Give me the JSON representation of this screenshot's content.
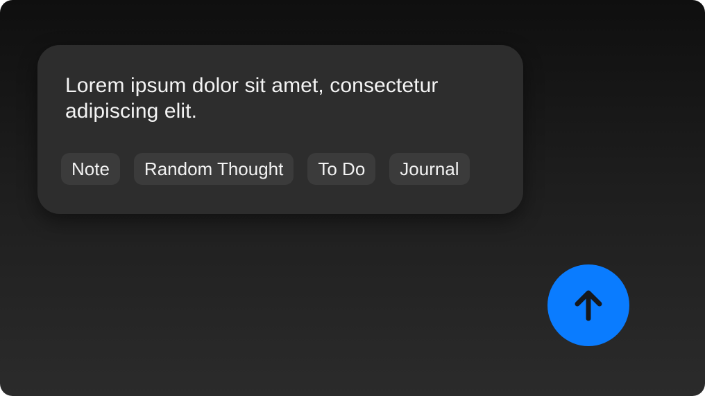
{
  "note": {
    "text": "Lorem ipsum dolor sit amet, consectetur adipiscing elit.",
    "tags": [
      {
        "label": "Note"
      },
      {
        "label": "Random Thought"
      },
      {
        "label": "To Do"
      },
      {
        "label": "Journal"
      }
    ]
  },
  "send_button": {
    "icon": "arrow-up-icon",
    "color": "#0a7cff"
  },
  "colors": {
    "card_background": "#2d2d2d",
    "tag_background": "#3b3b3b",
    "text": "#f4f4f4",
    "accent": "#0a7cff"
  }
}
